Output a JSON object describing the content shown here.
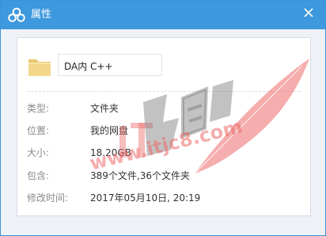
{
  "window": {
    "title": "属性"
  },
  "file": {
    "name": "DA内 C++",
    "icon": "folder-icon"
  },
  "properties": [
    {
      "label": "类型:",
      "value": "文件夹"
    },
    {
      "label": "位置:",
      "value": "我的网盘"
    },
    {
      "label": "大小:",
      "value": "18.20GB"
    },
    {
      "label": "包含:",
      "value": "389个文件,36个文件夹"
    },
    {
      "label": "修改时间:",
      "value": "2017年05月10日, 20:19"
    }
  ],
  "watermark": {
    "text": "IT教程吧",
    "url": "www.itjc8.com"
  },
  "colors": {
    "titlebar": "#3d98dd",
    "folder": "#f2d78b",
    "watermark": "#ec6a6a"
  }
}
